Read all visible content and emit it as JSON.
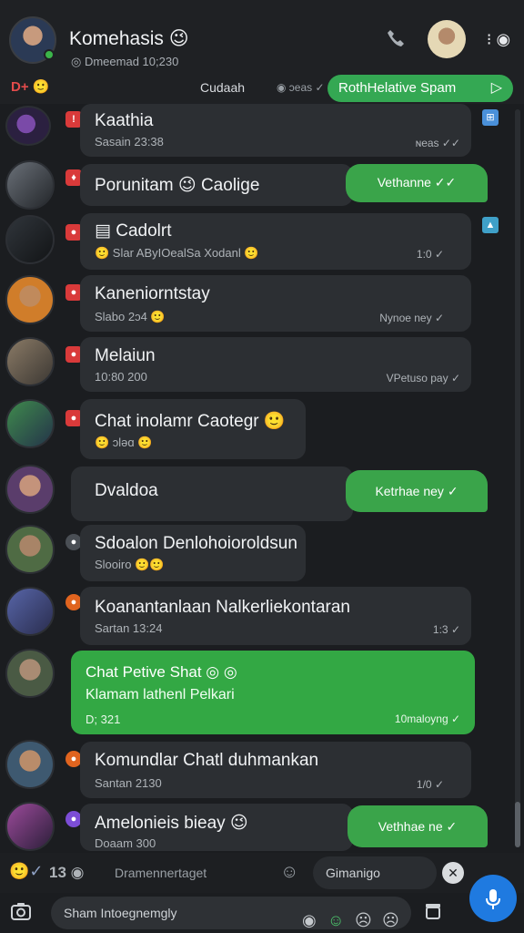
{
  "header": {
    "title": "Komehasis 😉",
    "subtitle": "◎ Dmeemad 10;230",
    "more_label": "⁝ ◉"
  },
  "filter": {
    "left_label": "D+ 🙂",
    "label": "Cudaah",
    "status": "◉ ɔeas ✓",
    "pill_label": "RothHelative Spam",
    "pill_arrow": "▷"
  },
  "chats": [
    {
      "name": "Kaathia",
      "sub": "Sasain 23:38",
      "time": "ɴeas ✓✓",
      "tag": "!",
      "tag_color": "#d93a3a"
    },
    {
      "name": "Porunitam 😉 Caolige",
      "reply": "Vethanne ✓✓",
      "tag": "♦",
      "tag_color": "#d93a3a"
    },
    {
      "name": "▤ Cadolrt",
      "sub": "🙂 Slar AByIOealSa Xodanl 🙂",
      "time": "1:0 ✓",
      "tag": "●",
      "tag_color": "#d93a3a"
    },
    {
      "name": "Kaneniorntstay",
      "sub": "Slabo 2ɔ4 🙂",
      "time": "Nynoe ney ✓",
      "tag": "●",
      "tag_color": "#d93a3a"
    },
    {
      "name": "Melaiun",
      "sub": "10:80 200",
      "time": "VPetuso pay ✓",
      "tag": "●",
      "tag_color": "#d93a3a"
    },
    {
      "name": "Chat inolamr Caotegr 🙂",
      "sub": "🙂 ɔləɑ 🙂",
      "tag": "●",
      "tag_color": "#d93a3a"
    },
    {
      "name": "Dvaldoa",
      "reply": "Ketrhae ney ✓",
      "tag": "",
      "tag_color": "#d93a3a"
    },
    {
      "name": "Sdoalon Denlohoioroldsun",
      "sub": "Slooiro 🙂🙂",
      "tag": "●",
      "tag_color": "#4a4f55"
    },
    {
      "name": "Koanantanlaan Nalkerliekontaran",
      "sub": "Sartan 13:24",
      "time": "1:3 ✓",
      "tag": "●",
      "tag_color": "#e0641f"
    },
    {
      "name": "Chat Petive Shat ◎ ◎",
      "sub": "Klamam lathenl Pelkari",
      "time": "10maloyng ✓",
      "date": "D; 321"
    },
    {
      "name": "Komundlar Chatl duhmankan",
      "sub": "Santan 2130",
      "time": "1/0 ✓",
      "tag": "●",
      "tag_color": "#e0641f"
    },
    {
      "name": "Amelonieis bieay 😉",
      "sub": "Doaam 300",
      "reply": "Vethhae ne ✓",
      "tag": "●",
      "tag_color": "#7c4dd6"
    }
  ],
  "quick_bar": {
    "icons": "🙂✓",
    "count": "13 ◉",
    "hint": "Dramennertaget",
    "pill": "Gimanigo",
    "close": "✕"
  },
  "input": {
    "placeholder": "Sham Intoegnemgly",
    "mic": "🎤"
  },
  "colors": {
    "accent_green": "#34a853",
    "mic_blue": "#1f7ae0",
    "bubble": "#2c2f33"
  }
}
